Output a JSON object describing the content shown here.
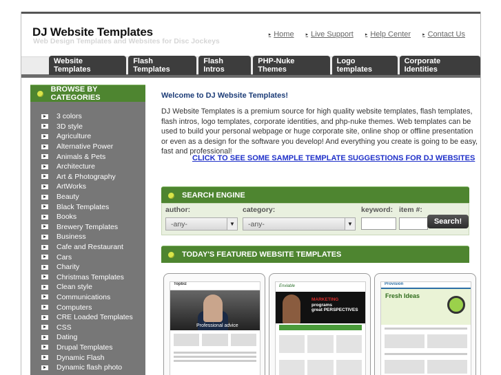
{
  "brand": {
    "title": "DJ Website Templates",
    "subtitle": "Web Design Templates and Websites for Disc Jockeys"
  },
  "top_links": [
    "Home",
    "Live Support",
    "Help Center",
    "Contact Us"
  ],
  "tabs": [
    "Website Templates",
    "Flash Templates",
    "Flash Intros",
    "PHP-Nuke Themes",
    "Logo templates",
    "Corporate Identities"
  ],
  "sidebar": {
    "heading": "BROWSE BY CATEGORIES",
    "categories": [
      "3 colors",
      "3D style",
      "Agriculture",
      "Alternative Power",
      "Animals & Pets",
      "Architecture",
      "Art & Photography",
      "ArtWorks",
      "Beauty",
      "Black Templates",
      "Books",
      "Brewery Templates",
      "Business",
      "Cafe and Restaurant",
      "Cars",
      "Charity",
      "Christmas Templates",
      "Clean style",
      "Communications",
      "Computers",
      "CRE Loaded Templates",
      "CSS",
      "Dating",
      "Drupal Templates",
      "Dynamic Flash",
      "Dynamic flash photo"
    ]
  },
  "main": {
    "welcome": "Welcome to DJ Website Templates!",
    "intro": "DJ Website Templates is a premium source for high quality website templates, flash templates, flash intros, logo templates, corporate identities, and php-nuke themes. Web templates can be used to build your personal webpage or huge corporate site, online shop or offline presentation or even as a design for the software you develop! And everything you create is going to be easy, fast and professional!",
    "cta": "CLICK TO SEE SOME SAMPLE TEMPLATE SUGGESTIONS FOR DJ WEBSITES"
  },
  "search": {
    "heading": "SEARCH ENGINE",
    "author_label": "author:",
    "author_value": "-any-",
    "category_label": "category:",
    "category_value": "-any-",
    "keyword_label": "keyword:",
    "item_label": "item #:",
    "button": "Search!"
  },
  "featured": {
    "heading": "TODAY'S FEATURED WEBSITE TEMPLATES",
    "thumbs": [
      {
        "brand": "Topbiz",
        "caption": "Professional advice"
      },
      {
        "brand": "Enviable",
        "marketing_top": "MARKETING",
        "marketing_mid": "programs",
        "marketing_bot": "great PERSPECTIVES"
      },
      {
        "brand": "Provision",
        "hero": "Fresh Ideas"
      }
    ]
  }
}
